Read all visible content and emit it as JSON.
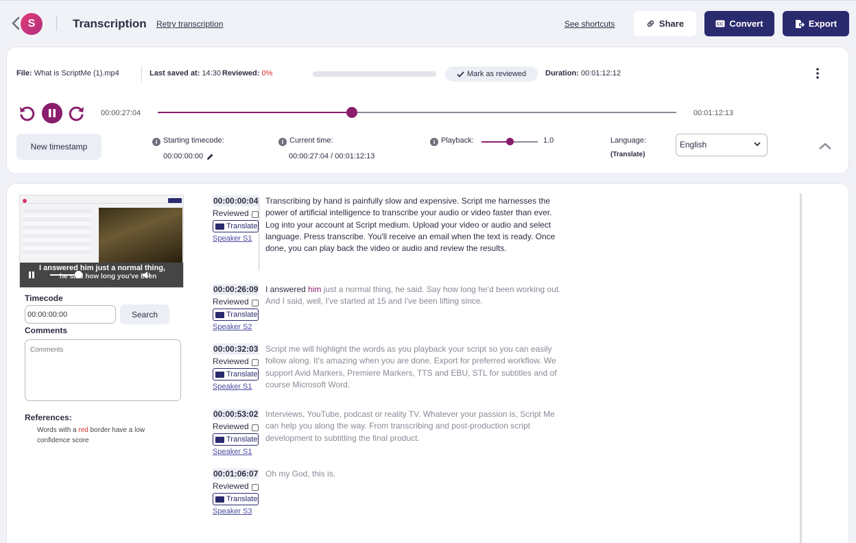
{
  "header": {
    "logo_text": "S",
    "title": "Transcription",
    "retry_label": "Retry transcription",
    "shortcuts_label": "See shortcuts",
    "share_label": "Share",
    "convert_label": "Convert",
    "export_label": "Export",
    "colors": {
      "accent": "#2a2a6e",
      "brand": "#8a1d6c",
      "alert": "#d32f2f"
    }
  },
  "fileinfo": {
    "file_label": "File:",
    "file_name": "What is ScriptMe (1).mp4",
    "saved_label": "Last saved at:",
    "saved_time": "14:30",
    "reviewed_label": "Reviewed:",
    "reviewed_pct": "0%",
    "reviewed_fraction": 0,
    "mark_label": "Mark as reviewed",
    "duration_label": "Duration:",
    "duration": "00:01:12:12"
  },
  "player": {
    "current": "00:00:27:04",
    "end": "00:01:12:13",
    "progress_fraction": 0.374
  },
  "controls": {
    "new_timestamp": "New timestamp",
    "starting_label": "Starting timecode:",
    "starting_value": "00:00:00:00",
    "current_label": "Current time:",
    "current_value": "00:00:27:04 / 00:01:12:13",
    "playback_label": "Playback:",
    "playback_value": "1.0",
    "playback_fraction": 0.5,
    "language_label": "Language:",
    "language_sub": "(Translate)",
    "language_value": "English"
  },
  "sidebar": {
    "caption_line1": "I answered him just a normal thing,",
    "caption_line2": "he said how long you've been",
    "timecode_label": "Timecode",
    "timecode_value": "00:00:00:00",
    "search_label": "Search",
    "comments_label": "Comments",
    "comments_placeholder": "Comments",
    "references_label": "References:",
    "ref_pre": "Words with a ",
    "ref_red": "red",
    "ref_post": " border have a low confidence score"
  },
  "segments": [
    {
      "time": "00:00:00:04",
      "reviewed": "Reviewed",
      "translate": "Translate",
      "speaker": "Speaker S1",
      "text": "Transcribing by hand is painfully slow and expensive. Script me harnesses the power of artificial intelligence to transcribe your audio or video faster than ever. Log into your account at Script medium. Upload your video or audio and select language. Press transcribe. You'll receive an email when the text is ready. Once done, you can play back the video or audio and review the results."
    },
    {
      "time": "00:00:26:09",
      "reviewed": "Reviewed",
      "translate": "Translate",
      "speaker": "Speaker S2",
      "text_a": "I answered ",
      "text_b": "him",
      "text_c": " just a normal thing, he said. Say how long he'd been working out. And I said, well, I've started at 15 and I've been lifting since."
    },
    {
      "time": "00:00:32:03",
      "reviewed": "Reviewed",
      "translate": "Translate",
      "speaker": "Speaker S1",
      "text": "Script me will highlight the words as you playback your script so you can easily follow along. It's amazing when you are done. Export for preferred workflow. We support Avid Markers, Premiere Markers, TTS and EBU, STL for subtitles and of course Microsoft Word."
    },
    {
      "time": "00:00:53:02",
      "reviewed": "Reviewed",
      "translate": "Translate",
      "speaker": "Speaker S1",
      "text": "Interviews, YouTube, podcast or reality TV. Whatever your passion is, Script Me can help you along the way. From transcribing and post-production script development to subtitling the final product."
    },
    {
      "time": "00:01:06:07",
      "reviewed": "Reviewed",
      "translate": "Translate",
      "speaker": "Speaker S3",
      "text": "Oh my God, this is."
    }
  ]
}
